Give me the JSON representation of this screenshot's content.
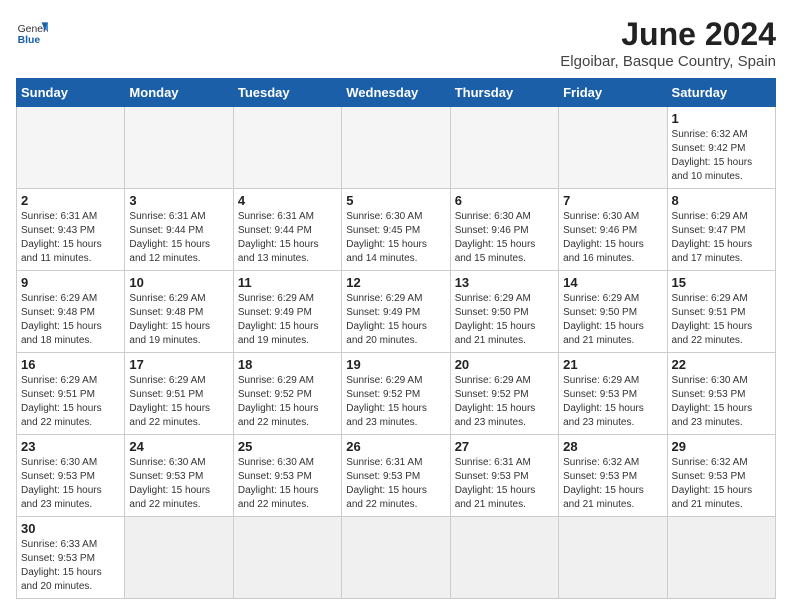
{
  "header": {
    "logo_general": "General",
    "logo_blue": "Blue",
    "title": "June 2024",
    "location": "Elgoibar, Basque Country, Spain"
  },
  "weekdays": [
    "Sunday",
    "Monday",
    "Tuesday",
    "Wednesday",
    "Thursday",
    "Friday",
    "Saturday"
  ],
  "weeks": [
    [
      {
        "day": "",
        "info": "",
        "empty": true
      },
      {
        "day": "",
        "info": "",
        "empty": true
      },
      {
        "day": "",
        "info": "",
        "empty": true
      },
      {
        "day": "",
        "info": "",
        "empty": true
      },
      {
        "day": "",
        "info": "",
        "empty": true
      },
      {
        "day": "",
        "info": "",
        "empty": true
      },
      {
        "day": "1",
        "info": "Sunrise: 6:32 AM\nSunset: 9:42 PM\nDaylight: 15 hours\nand 10 minutes."
      }
    ],
    [
      {
        "day": "2",
        "info": "Sunrise: 6:31 AM\nSunset: 9:43 PM\nDaylight: 15 hours\nand 11 minutes."
      },
      {
        "day": "3",
        "info": "Sunrise: 6:31 AM\nSunset: 9:44 PM\nDaylight: 15 hours\nand 12 minutes."
      },
      {
        "day": "4",
        "info": "Sunrise: 6:31 AM\nSunset: 9:44 PM\nDaylight: 15 hours\nand 13 minutes."
      },
      {
        "day": "5",
        "info": "Sunrise: 6:30 AM\nSunset: 9:45 PM\nDaylight: 15 hours\nand 14 minutes."
      },
      {
        "day": "6",
        "info": "Sunrise: 6:30 AM\nSunset: 9:46 PM\nDaylight: 15 hours\nand 15 minutes."
      },
      {
        "day": "7",
        "info": "Sunrise: 6:30 AM\nSunset: 9:46 PM\nDaylight: 15 hours\nand 16 minutes."
      },
      {
        "day": "8",
        "info": "Sunrise: 6:29 AM\nSunset: 9:47 PM\nDaylight: 15 hours\nand 17 minutes."
      }
    ],
    [
      {
        "day": "9",
        "info": "Sunrise: 6:29 AM\nSunset: 9:48 PM\nDaylight: 15 hours\nand 18 minutes."
      },
      {
        "day": "10",
        "info": "Sunrise: 6:29 AM\nSunset: 9:48 PM\nDaylight: 15 hours\nand 19 minutes."
      },
      {
        "day": "11",
        "info": "Sunrise: 6:29 AM\nSunset: 9:49 PM\nDaylight: 15 hours\nand 19 minutes."
      },
      {
        "day": "12",
        "info": "Sunrise: 6:29 AM\nSunset: 9:49 PM\nDaylight: 15 hours\nand 20 minutes."
      },
      {
        "day": "13",
        "info": "Sunrise: 6:29 AM\nSunset: 9:50 PM\nDaylight: 15 hours\nand 21 minutes."
      },
      {
        "day": "14",
        "info": "Sunrise: 6:29 AM\nSunset: 9:50 PM\nDaylight: 15 hours\nand 21 minutes."
      },
      {
        "day": "15",
        "info": "Sunrise: 6:29 AM\nSunset: 9:51 PM\nDaylight: 15 hours\nand 22 minutes."
      }
    ],
    [
      {
        "day": "16",
        "info": "Sunrise: 6:29 AM\nSunset: 9:51 PM\nDaylight: 15 hours\nand 22 minutes."
      },
      {
        "day": "17",
        "info": "Sunrise: 6:29 AM\nSunset: 9:51 PM\nDaylight: 15 hours\nand 22 minutes."
      },
      {
        "day": "18",
        "info": "Sunrise: 6:29 AM\nSunset: 9:52 PM\nDaylight: 15 hours\nand 22 minutes."
      },
      {
        "day": "19",
        "info": "Sunrise: 6:29 AM\nSunset: 9:52 PM\nDaylight: 15 hours\nand 23 minutes."
      },
      {
        "day": "20",
        "info": "Sunrise: 6:29 AM\nSunset: 9:52 PM\nDaylight: 15 hours\nand 23 minutes."
      },
      {
        "day": "21",
        "info": "Sunrise: 6:29 AM\nSunset: 9:53 PM\nDaylight: 15 hours\nand 23 minutes."
      },
      {
        "day": "22",
        "info": "Sunrise: 6:30 AM\nSunset: 9:53 PM\nDaylight: 15 hours\nand 23 minutes."
      }
    ],
    [
      {
        "day": "23",
        "info": "Sunrise: 6:30 AM\nSunset: 9:53 PM\nDaylight: 15 hours\nand 23 minutes."
      },
      {
        "day": "24",
        "info": "Sunrise: 6:30 AM\nSunset: 9:53 PM\nDaylight: 15 hours\nand 22 minutes."
      },
      {
        "day": "25",
        "info": "Sunrise: 6:30 AM\nSunset: 9:53 PM\nDaylight: 15 hours\nand 22 minutes."
      },
      {
        "day": "26",
        "info": "Sunrise: 6:31 AM\nSunset: 9:53 PM\nDaylight: 15 hours\nand 22 minutes."
      },
      {
        "day": "27",
        "info": "Sunrise: 6:31 AM\nSunset: 9:53 PM\nDaylight: 15 hours\nand 21 minutes."
      },
      {
        "day": "28",
        "info": "Sunrise: 6:32 AM\nSunset: 9:53 PM\nDaylight: 15 hours\nand 21 minutes."
      },
      {
        "day": "29",
        "info": "Sunrise: 6:32 AM\nSunset: 9:53 PM\nDaylight: 15 hours\nand 21 minutes."
      }
    ],
    [
      {
        "day": "30",
        "info": "Sunrise: 6:33 AM\nSunset: 9:53 PM\nDaylight: 15 hours\nand 20 minutes."
      },
      {
        "day": "",
        "info": "",
        "empty": true
      },
      {
        "day": "",
        "info": "",
        "empty": true
      },
      {
        "day": "",
        "info": "",
        "empty": true
      },
      {
        "day": "",
        "info": "",
        "empty": true
      },
      {
        "day": "",
        "info": "",
        "empty": true
      },
      {
        "day": "",
        "info": "",
        "empty": true
      }
    ]
  ]
}
